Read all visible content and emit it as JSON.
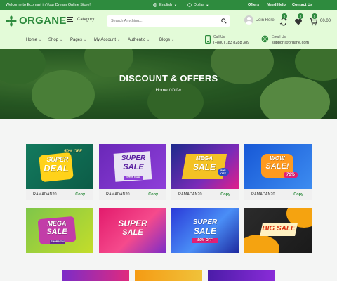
{
  "topbar": {
    "welcome": "Welcome to Ecomart in Your Dream Online Store!",
    "language": "English",
    "currency": "Dollar",
    "links": [
      "Offers",
      "Need Help",
      "Contact Us"
    ]
  },
  "header": {
    "logo": "ORGANE",
    "category_label": "Category",
    "search_placeholder": "Search Anything...",
    "join_label": "Join Here",
    "compare_count": "0",
    "wishlist_count": "0",
    "cart_count": "0",
    "cart_total": "00.00"
  },
  "nav": {
    "items": [
      "Home",
      "Shop",
      "Pages",
      "My Account",
      "Authentic",
      "Blogs"
    ],
    "call_label": "Call Us",
    "call_value": "(+880) 183 8288 389",
    "email_label": "Email Us",
    "email_value": "support@organe.com"
  },
  "hero": {
    "title": "DISCOUNT & OFFERS",
    "crumb_home": "Home",
    "crumb_sep": "/",
    "crumb_current": "Offer"
  },
  "coupons": [
    {
      "code": "RAMADAN20",
      "copy": "Copy",
      "line1": "SUPER",
      "line2": "DEAL",
      "extra": "50% OFF"
    },
    {
      "code": "RAMADAN20",
      "copy": "Copy",
      "line1": "SUPER",
      "line2": "SALE",
      "extra": "SHOP NOW"
    },
    {
      "code": "RAMADAN20",
      "copy": "Copy",
      "line1": "MEGA",
      "line2": "SALE",
      "extra": "50% OFF"
    },
    {
      "code": "RAMADAN20",
      "copy": "Copy",
      "line1": "WOW",
      "line2": "SALE!",
      "extra": "70%"
    },
    {
      "code": "",
      "copy": "",
      "line1": "MEGA",
      "line2": "SALE",
      "extra": "SHOP NOW"
    },
    {
      "code": "",
      "copy": "",
      "line1": "SUPER",
      "line2": "SALE",
      "extra": ""
    },
    {
      "code": "",
      "copy": "",
      "line1": "SUPER",
      "line2": "SALE",
      "extra": "50% OFF"
    },
    {
      "code": "",
      "copy": "",
      "line1": "BIG",
      "line2": "SALE",
      "extra": ""
    }
  ],
  "colors": {
    "brand": "#2e8b3e",
    "header_bg": "#e3fbd8"
  }
}
